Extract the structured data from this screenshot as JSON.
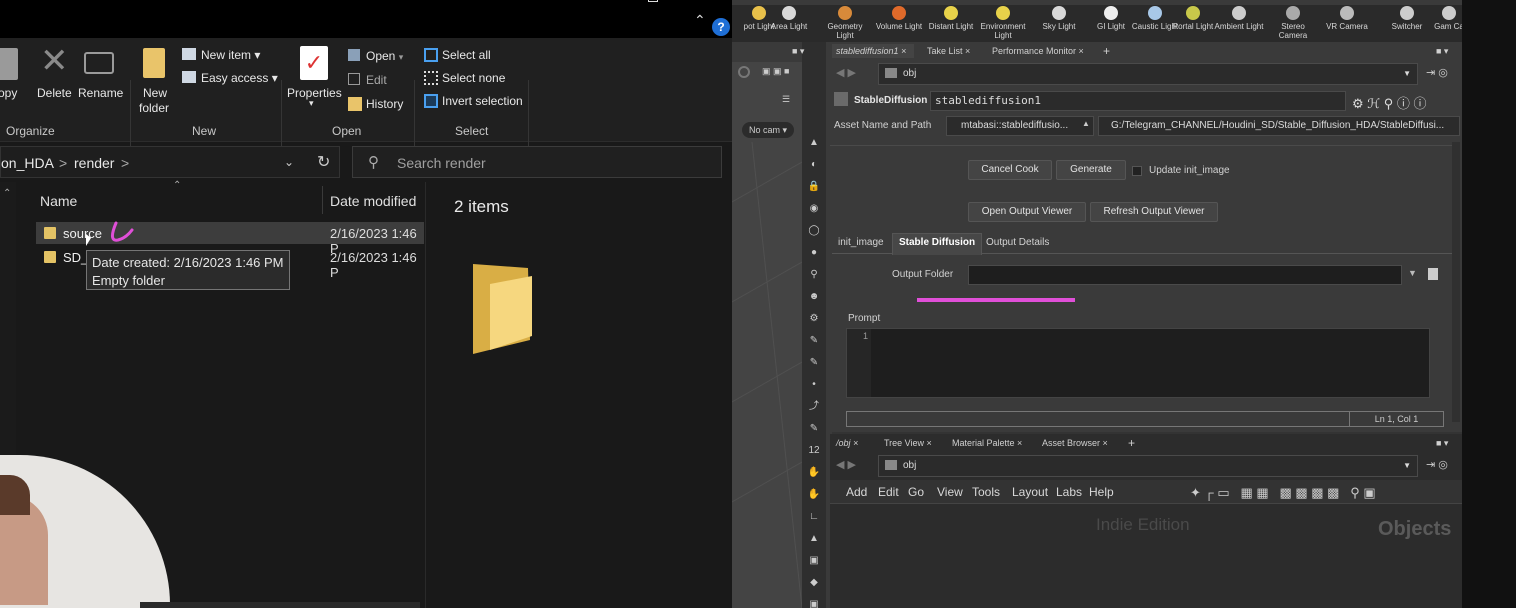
{
  "explorer": {
    "ribbon": {
      "copy_label": "opy",
      "delete_label": "Delete",
      "rename_label": "Rename",
      "new_folder_label_1": "New",
      "new_folder_label_2": "folder",
      "new_item_label": "New item",
      "easy_access_label": "Easy access",
      "properties_label": "Properties",
      "open_label": "Open",
      "edit_label": "Edit",
      "history_label": "History",
      "select_all_label": "Select all",
      "select_none_label": "Select none",
      "invert_selection_label": "Invert selection",
      "groups": {
        "organize": "Organize",
        "new": "New",
        "open": "Open",
        "select": "Select"
      }
    },
    "address": {
      "segment_1": "on_HDA",
      "separator": ">",
      "segment_2": "render",
      "separator_2": ">"
    },
    "search": {
      "placeholder": "Search render"
    },
    "columns": {
      "name": "Name",
      "date_modified": "Date modified"
    },
    "files": [
      {
        "name": "source",
        "date": "2/16/2023 1:46 P"
      },
      {
        "name": "SD_",
        "date": "2/16/2023 1:46 P"
      }
    ],
    "tooltip": {
      "line1": "Date created: 2/16/2023 1:46 PM",
      "line2": "Empty folder"
    },
    "preview": {
      "count": "2 items"
    }
  },
  "houdini": {
    "shelf_tools": [
      "pot Light",
      "Area Light",
      "Geometry Light",
      "Volume Light",
      "Distant Light",
      "Environment Light",
      "Sky Light",
      "GI Light",
      "Caustic Light",
      "Portal Light",
      "Ambient Light",
      "Stereo Camera",
      "VR Camera",
      "Switcher",
      "Gam Ca"
    ],
    "pane_tabs": [
      "stablediffusion1",
      "Take List",
      "Performance Monitor"
    ],
    "path": "obj",
    "viewport": {
      "cam": "No cam"
    },
    "node": {
      "type": "StableDiffusion",
      "name": "stablediffusion1"
    },
    "asset": {
      "label": "Asset Name and Path",
      "name": "mtabasi::stablediffusio...",
      "path": "G:/Telegram_CHANNEL/Houdini_SD/Stable_Diffusion_HDA/StableDiffusi..."
    },
    "buttons": {
      "cancel_cook": "Cancel Cook",
      "generate": "Generate",
      "update_init": "Update init_image",
      "open_output_viewer": "Open Output Viewer",
      "refresh_output_viewer": "Refresh Output Viewer"
    },
    "param_tabs": [
      "init_image",
      "Stable Diffusion",
      "Output Details"
    ],
    "output_folder": {
      "label": "Output Folder",
      "value": ""
    },
    "prompt": {
      "label": "Prompt",
      "line_number": "1",
      "status": "Ln 1, Col 1"
    },
    "lower_tabs": [
      "/obj",
      "Tree View",
      "Material Palette",
      "Asset Browser"
    ],
    "lower_path": "obj",
    "menu": [
      "Add",
      "Edit",
      "Go",
      "View",
      "Tools",
      "Layout",
      "Labs",
      "Help"
    ],
    "network": {
      "watermark": "Indie Edition",
      "context_label": "Objects"
    },
    "colors": {
      "highlight": "#e04fd8",
      "folder": "#e9c46a"
    }
  }
}
